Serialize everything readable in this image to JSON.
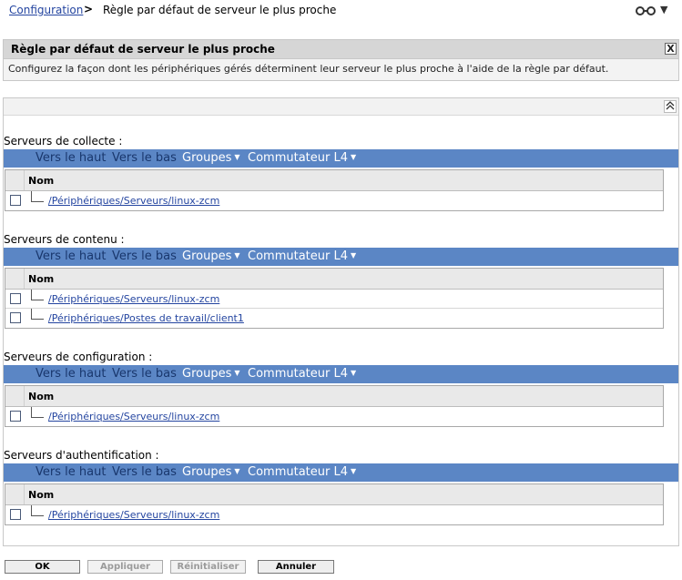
{
  "breadcrumb": {
    "link": "Configuration",
    "separator": ">",
    "current": "Règle par défaut de serveur le plus proche"
  },
  "top_icons": [
    "glasses-icon",
    "chevron-down-icon"
  ],
  "top_arrow": "▼",
  "info": {
    "title": "Règle par défaut de serveur le plus proche",
    "close": "X",
    "description": "Configurez la façon dont les périphériques gérés déterminent leur serveur le plus proche à l'aide de la règle par défaut."
  },
  "collapse_glyph": "︽",
  "toolbar": {
    "up": "Vers le haut",
    "down": "Vers le bas",
    "groups": "Groupes",
    "switch": "Commutateur L4",
    "caret": "▼"
  },
  "column_header": "Nom",
  "sections": [
    {
      "label": "Serveurs de collecte :",
      "rows": [
        "/Périphériques/Serveurs/linux-zcm"
      ]
    },
    {
      "label": "Serveurs de contenu :",
      "rows": [
        "/Périphériques/Serveurs/linux-zcm",
        "/Périphériques/Postes de travail/client1"
      ]
    },
    {
      "label": "Serveurs de configuration :",
      "rows": [
        "/Périphériques/Serveurs/linux-zcm"
      ]
    },
    {
      "label": "Serveurs d'authentification :",
      "rows": [
        "/Périphériques/Serveurs/linux-zcm"
      ]
    }
  ],
  "buttons": {
    "ok": "OK",
    "apply": "Appliquer",
    "reset": "Réinitialiser",
    "cancel": "Annuler"
  },
  "colors": {
    "toolbar_bg": "#5b86c5",
    "link": "#2445a0"
  }
}
